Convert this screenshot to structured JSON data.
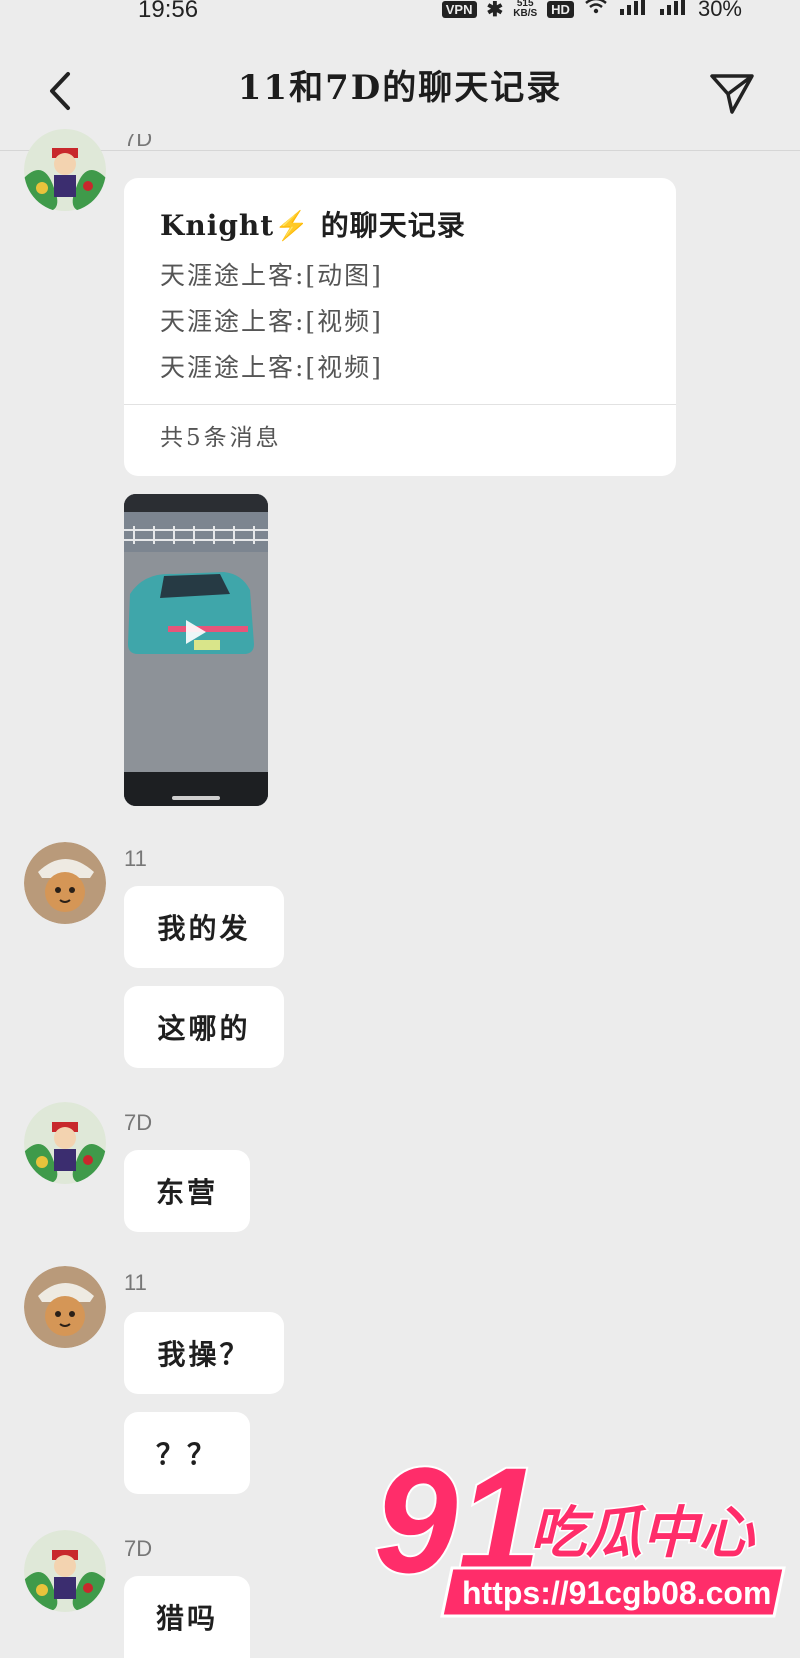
{
  "status_bar": {
    "time": "19:56",
    "vpn": "VPN",
    "speed": "515\nKB/S",
    "hd": "HD",
    "battery": "30%"
  },
  "header": {
    "title": "11和7D的聊天记录",
    "back_icon": "chevron-left-icon",
    "send_icon": "send-icon"
  },
  "messages": [
    {
      "sender": "7D",
      "type": "forwarded-record",
      "card": {
        "title": "Knight⚡ 的聊天记录",
        "lines": [
          "天涯途上客:[动图]",
          "天涯途上客:[视频]",
          "天涯途上客:[视频]"
        ],
        "footer": "共5条消息"
      }
    },
    {
      "sender": "7D",
      "type": "video"
    },
    {
      "sender": "11",
      "type": "text",
      "text": "我的发"
    },
    {
      "sender": "11",
      "type": "text",
      "text": "这哪的"
    },
    {
      "sender": "7D",
      "type": "text",
      "text": "东营"
    },
    {
      "sender": "11",
      "type": "text",
      "text": "我操？"
    },
    {
      "sender": "11",
      "type": "text",
      "text": "？？"
    },
    {
      "sender": "7D",
      "type": "text",
      "text": "猎吗"
    }
  ],
  "watermark": {
    "logo_number": "91",
    "logo_text": "吃瓜中心",
    "url": "https://91cgb08.com"
  },
  "colors": {
    "background": "#ececec",
    "bubble": "#ffffff",
    "watermark_pink": "#ff2d6a"
  }
}
